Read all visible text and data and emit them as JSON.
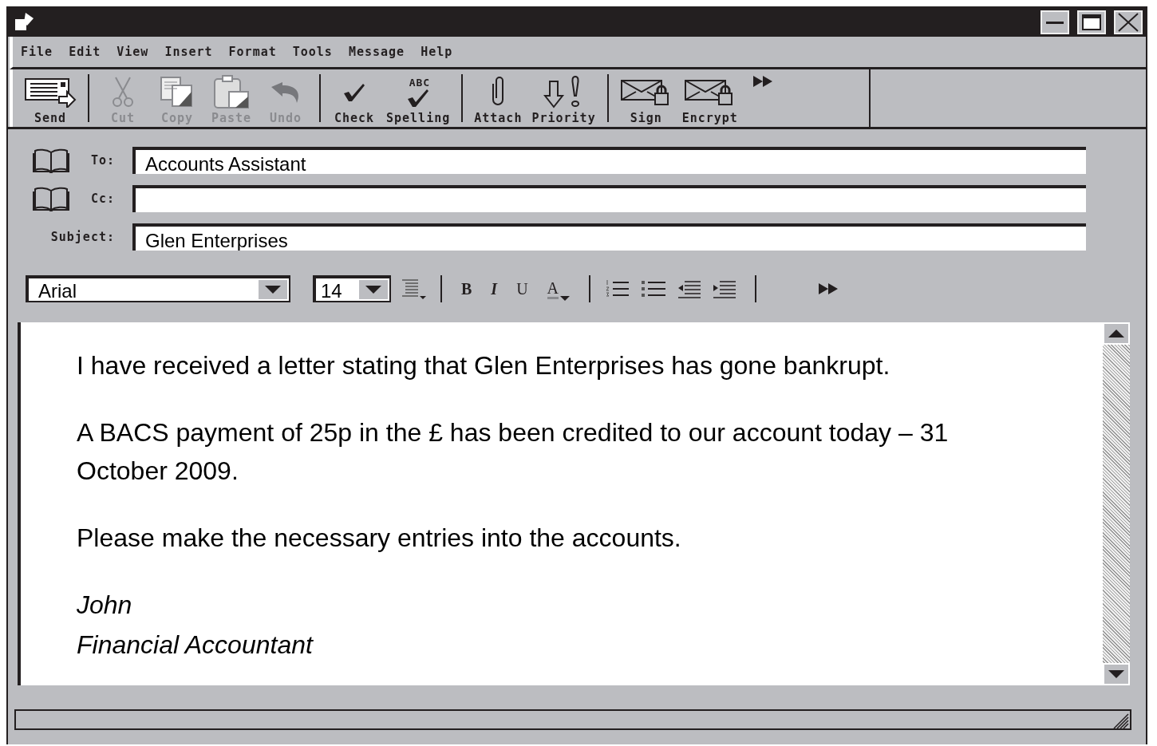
{
  "menu": [
    "File",
    "Edit",
    "View",
    "Insert",
    "Format",
    "Tools",
    "Message",
    "Help"
  ],
  "toolbar": [
    {
      "kind": "send",
      "label": "Send",
      "disabled": false
    },
    {
      "kind": "separator"
    },
    {
      "kind": "cut",
      "label": "Cut",
      "disabled": true
    },
    {
      "kind": "copy",
      "label": "Copy",
      "disabled": true
    },
    {
      "kind": "paste",
      "label": "Paste",
      "disabled": true
    },
    {
      "kind": "undo",
      "label": "Undo",
      "disabled": true
    },
    {
      "kind": "separator"
    },
    {
      "kind": "check",
      "label": "Check",
      "disabled": false
    },
    {
      "kind": "spelling",
      "label": "Spelling",
      "icon_text": "ABC",
      "disabled": false
    },
    {
      "kind": "separator"
    },
    {
      "kind": "attach",
      "label": "Attach",
      "disabled": false
    },
    {
      "kind": "priority",
      "label": "Priority",
      "disabled": false
    },
    {
      "kind": "separator"
    },
    {
      "kind": "sign",
      "label": "Sign",
      "disabled": false
    },
    {
      "kind": "encrypt",
      "label": "Encrypt",
      "disabled": false
    },
    {
      "kind": "more"
    }
  ],
  "fields": [
    {
      "label": "To:",
      "value": "Accounts Assistant",
      "address_book": true
    },
    {
      "label": "Cc:",
      "address_book": true
    },
    {
      "label": "Subject:",
      "value": "Glen Enterprises",
      "address_book": false
    }
  ],
  "format_bar": {
    "font": "Arial",
    "size": "14",
    "style_buttons": [
      {
        "kind": "bold",
        "label": "B"
      },
      {
        "kind": "italic",
        "label": "I"
      },
      {
        "kind": "underline",
        "label": "U"
      },
      {
        "kind": "color",
        "label": "A"
      }
    ]
  },
  "body": {
    "paragraphs": [
      {
        "text": "I have received a letter stating that Glen Enterprises has gone bankrupt.",
        "italic": false
      },
      {
        "text": "A BACS payment of 25p in the £ has been credited to our account today – 31 October 2009.",
        "italic": false
      },
      {
        "text": "Please make the necessary entries into the accounts.",
        "italic": false
      },
      {
        "text": "John",
        "italic": true
      },
      {
        "text": "Financial Accountant",
        "italic": true
      }
    ]
  }
}
